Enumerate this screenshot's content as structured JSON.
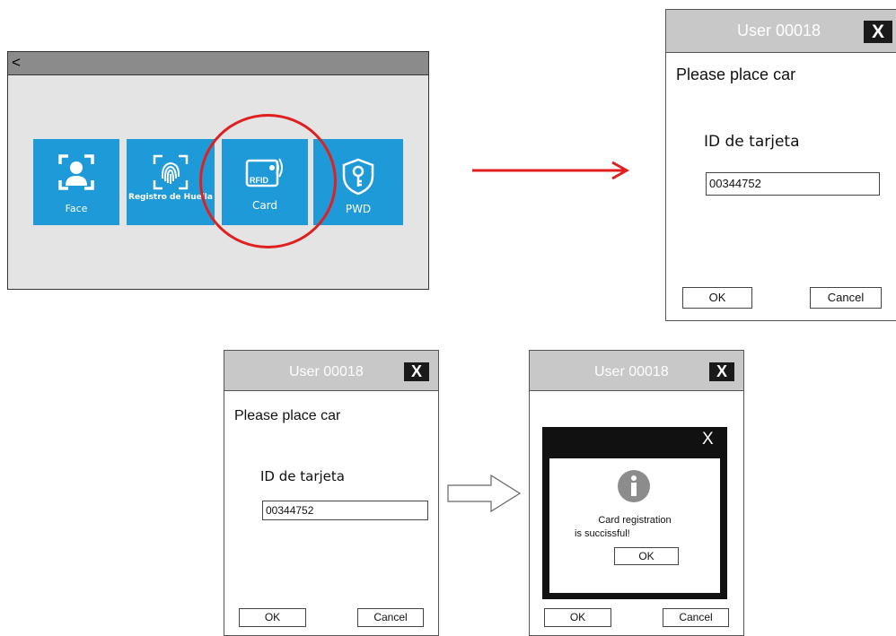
{
  "menu": {
    "back": "<",
    "tiles": [
      {
        "label": "Face",
        "icon": "face-scan-icon"
      },
      {
        "label": "Registro de Huella",
        "icon": "fingerprint-icon"
      },
      {
        "label": "Card",
        "icon": "rfid-card-icon",
        "badge": "RFID"
      },
      {
        "label": "PWD",
        "icon": "key-shield-icon"
      }
    ]
  },
  "colors": {
    "tile": "#1f9ad8",
    "highlight": "#e02020",
    "titlebar": "#c8c8c8"
  },
  "card_dialog": {
    "title": "User 00018",
    "close": "X",
    "prompt": "Please place car",
    "id_label": "ID de tarjeta",
    "id_value": "00344752",
    "ok": "OK",
    "cancel": "Cancel"
  },
  "success_popup": {
    "close": "X",
    "icon": "info-icon",
    "line1": "Card registration",
    "line2": "is succissful!",
    "ok": "OK"
  }
}
